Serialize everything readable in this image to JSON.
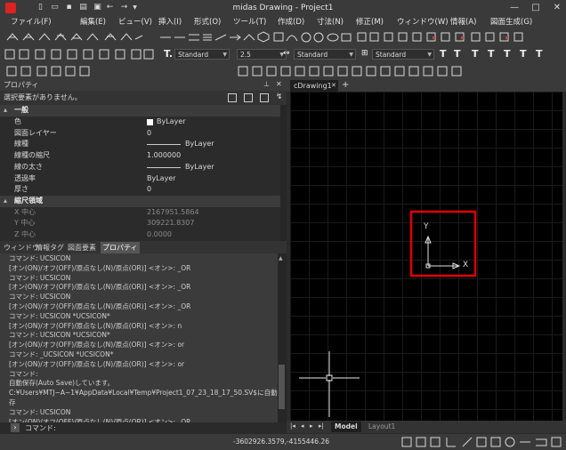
{
  "window": {
    "title": "midas Drawing - Project1",
    "minimize": "—",
    "maximize": "□",
    "close": "✕"
  },
  "menu": [
    "ファイル(F)",
    "編集(E)",
    "ビュー(V)",
    "挿入(I)",
    "形式(O)",
    "ツール(T)",
    "作成(D)",
    "寸法(N)",
    "修正(M)",
    "ウィンドウ(W)",
    "情報(A)",
    "図面生成(G)"
  ],
  "toolbar": {
    "text_style": "Standard",
    "text_height": "2.5",
    "dim_style": "Standard",
    "table_style": "Standard"
  },
  "properties": {
    "header": "プロパティ",
    "selection": "選択要素がありません。",
    "sections": {
      "general": "一般",
      "scale": "縮尺領域"
    },
    "rows": [
      {
        "key": "色",
        "value": "ByLayer"
      },
      {
        "key": "図面レイヤー",
        "value": "0"
      },
      {
        "key": "線種",
        "value": "ByLayer"
      },
      {
        "key": "線種の縮尺",
        "value": "1.000000"
      },
      {
        "key": "線の太さ",
        "value": "ByLayer"
      },
      {
        "key": "透過率",
        "value": "ByLayer"
      },
      {
        "key": "厚さ",
        "value": "0"
      }
    ],
    "scale_rows": [
      {
        "key": "X 中心",
        "value": "2167951.5864"
      },
      {
        "key": "Y 中心",
        "value": "309221.8307"
      },
      {
        "key": "Z 中心",
        "value": "0.0000"
      }
    ]
  },
  "panel_tabs": [
    "ウィンドウ",
    "情報タグ",
    "図面要素",
    "プロパティ"
  ],
  "command_history": [
    "コマンド: UCSICON",
    "[オン(ON)/オフ(OFF)/原点なし(N)/原点(OR)] <オン>: _OR",
    "コマンド: UCSICON",
    "[オン(ON)/オフ(OFF)/原点なし(N)/原点(OR)] <オン>: _OR",
    "コマンド: UCSICON",
    "[オン(ON)/オフ(OFF)/原点なし(N)/原点(OR)] <オン>: _OR",
    "コマンド: UCSICON *UCSICON*",
    "[オン(ON)/オフ(OFF)/原点なし(N)/原点(OR)] <オン>: n",
    "コマンド: UCSICON *UCSICON*",
    "[オン(ON)/オフ(OFF)/原点なし(N)/原点(OR)] <オン>: or",
    "コマンド: _UCSICON *UCSICON*",
    "[オン(ON)/オフ(OFF)/原点なし(N)/原点(OR)] <オン>: or",
    "コマンド:",
    "自動保存(Auto Save)しています。",
    "C:¥Users¥MTJ~A~1¥AppData¥Local¥Temp¥Project1_07_23_18_17_50.SV$に自動",
    "存",
    "コマンド: UCSICON",
    "[オン(ON)/オフ(OFF)/原点なし(N)/原点(OR)] <オン>: _OR"
  ],
  "command_prompt": "コマンド:",
  "drawing": {
    "tab": "cDrawing1",
    "tab_close": "✕",
    "tab_add": "+",
    "axis_x": "X",
    "axis_y": "Y",
    "highlight_color": "#e00000"
  },
  "layout_tabs": [
    "Model",
    "Layout1"
  ],
  "status": {
    "coordinates": "-3602926.3579,-4155446.26"
  }
}
